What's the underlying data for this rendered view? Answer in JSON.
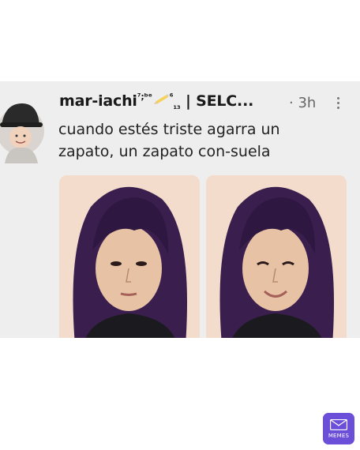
{
  "tweet": {
    "author": {
      "name_main": "mar-iachi",
      "name_sup": "⁷;ᵇᵉ",
      "name_sup2": "⁶",
      "name_sub": "₁₃",
      "name_tail": " | SELC...",
      "avatar_icon": "user-avatar-bucket-hat"
    },
    "time": "· 3h",
    "more_icon": "vertical-ellipsis-icon",
    "text": "cuando estés triste agarra un zapato, un zapato con-suela",
    "media": [
      {
        "alt_icon": "photo-serious-face"
      },
      {
        "alt_icon": "photo-smiling-face"
      }
    ]
  },
  "watermark": {
    "label": "MEMES",
    "brand_color": "#6b4fd8"
  }
}
